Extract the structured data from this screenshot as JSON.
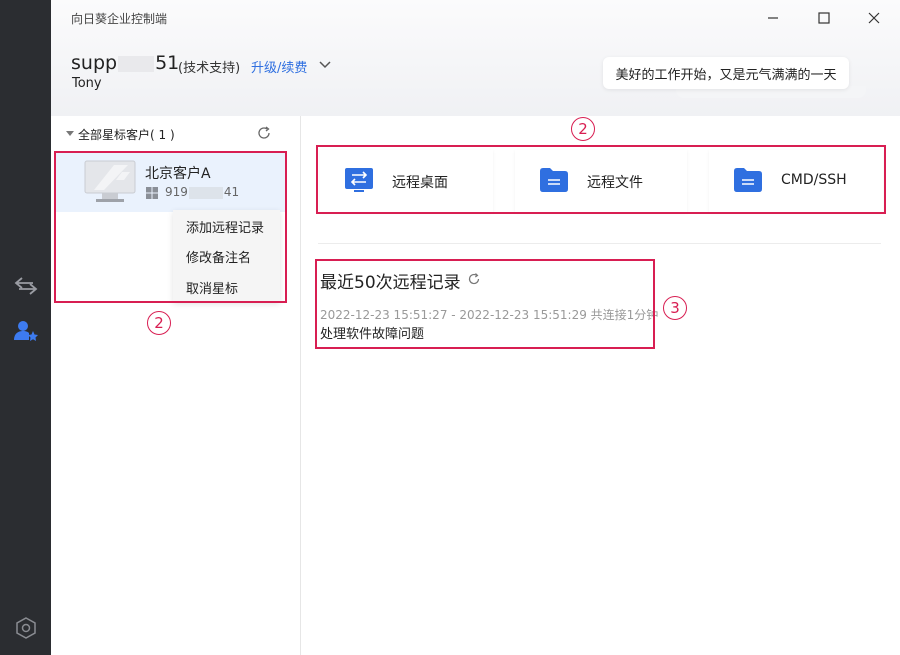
{
  "window": {
    "title": "向日葵企业控制端"
  },
  "window_controls": {
    "minimize": "minimize",
    "maximize": "maximize",
    "close": "close"
  },
  "user": {
    "id_prefix": "supp",
    "id_suffix": "51",
    "role": "(技术支持)",
    "upgrade_label": "升级/续费",
    "name": "Tony"
  },
  "bubble": {
    "text": "美好的工作开始，又是元气满满的一天"
  },
  "sidebar_rail": {
    "items": [
      {
        "icon": "remote-switch-icon"
      },
      {
        "icon": "starred-clients-icon"
      },
      {
        "icon": "settings-hex-icon"
      }
    ]
  },
  "star_group": {
    "label": "全部星标客户( 1 )"
  },
  "client": {
    "name": "北京客户A",
    "id_prefix": "919",
    "id_suffix": "41",
    "os_icon": "windows-icon"
  },
  "context_menu": {
    "items": [
      "添加远程记录",
      "修改备注名",
      "取消星标"
    ]
  },
  "actions": [
    {
      "label": "远程桌面",
      "icon": "remote-desktop-icon"
    },
    {
      "label": "远程文件",
      "icon": "folder-icon"
    },
    {
      "label": "CMD/SSH",
      "icon": "folder-icon"
    }
  ],
  "recent": {
    "title": "最近50次远程记录",
    "time": "2022-12-23 15:51:27 - 2022-12-23 15:51:29 共连接1分钟",
    "desc": "处理软件故障问题"
  },
  "annotations": {
    "left_marker": "2",
    "top_marker": "2",
    "recent_marker": "3"
  },
  "colors": {
    "accent": "#2f6fe0",
    "annotation_red": "#d81e52",
    "rail_bg": "#2b2d31",
    "selected_row": "#eaf2fd"
  }
}
